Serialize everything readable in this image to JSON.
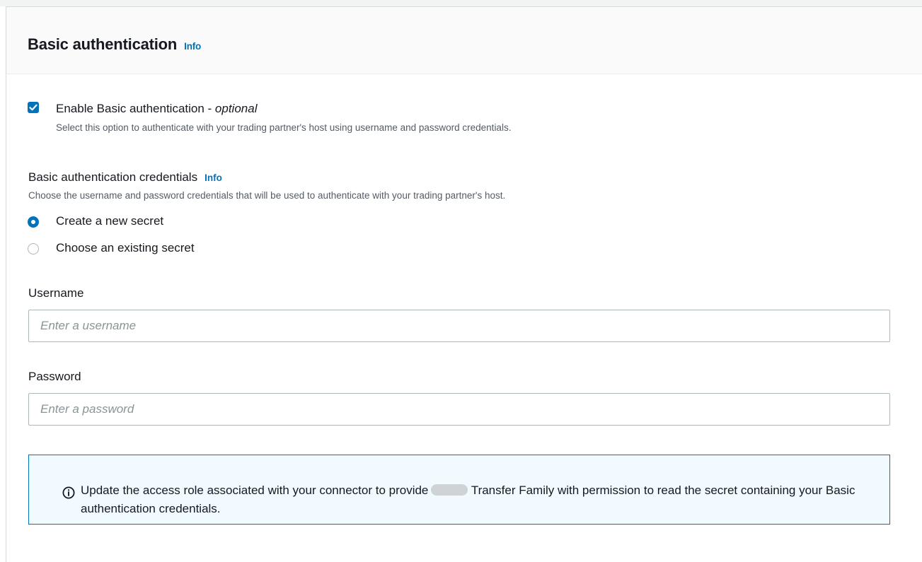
{
  "section": {
    "title": "Basic authentication",
    "info_label": "Info"
  },
  "enable_option": {
    "label": "Enable Basic authentication - ",
    "label_suffix": "optional",
    "checked": true,
    "description": "Select this option to authenticate with your trading partner's host using username and password credentials."
  },
  "credentials": {
    "label": "Basic authentication credentials",
    "info_label": "Info",
    "description": "Choose the username and password credentials that will be used to authenticate with your trading partner's host.",
    "options": [
      {
        "label": "Create a new secret",
        "selected": true
      },
      {
        "label": "Choose an existing secret",
        "selected": false
      }
    ]
  },
  "username": {
    "label": "Username",
    "placeholder": "Enter a username",
    "value": ""
  },
  "password": {
    "label": "Password",
    "placeholder": "Enter a password",
    "value": ""
  },
  "alert": {
    "text_before": "Update the access role associated with your connector to provide",
    "text_after": "Transfer Family with permission to read the secret containing your Basic authentication credentials.",
    "icon": "info-circle-icon"
  },
  "colors": {
    "accent": "#0073bb",
    "alert_background": "#f1faff",
    "header_background": "#fafafa"
  }
}
